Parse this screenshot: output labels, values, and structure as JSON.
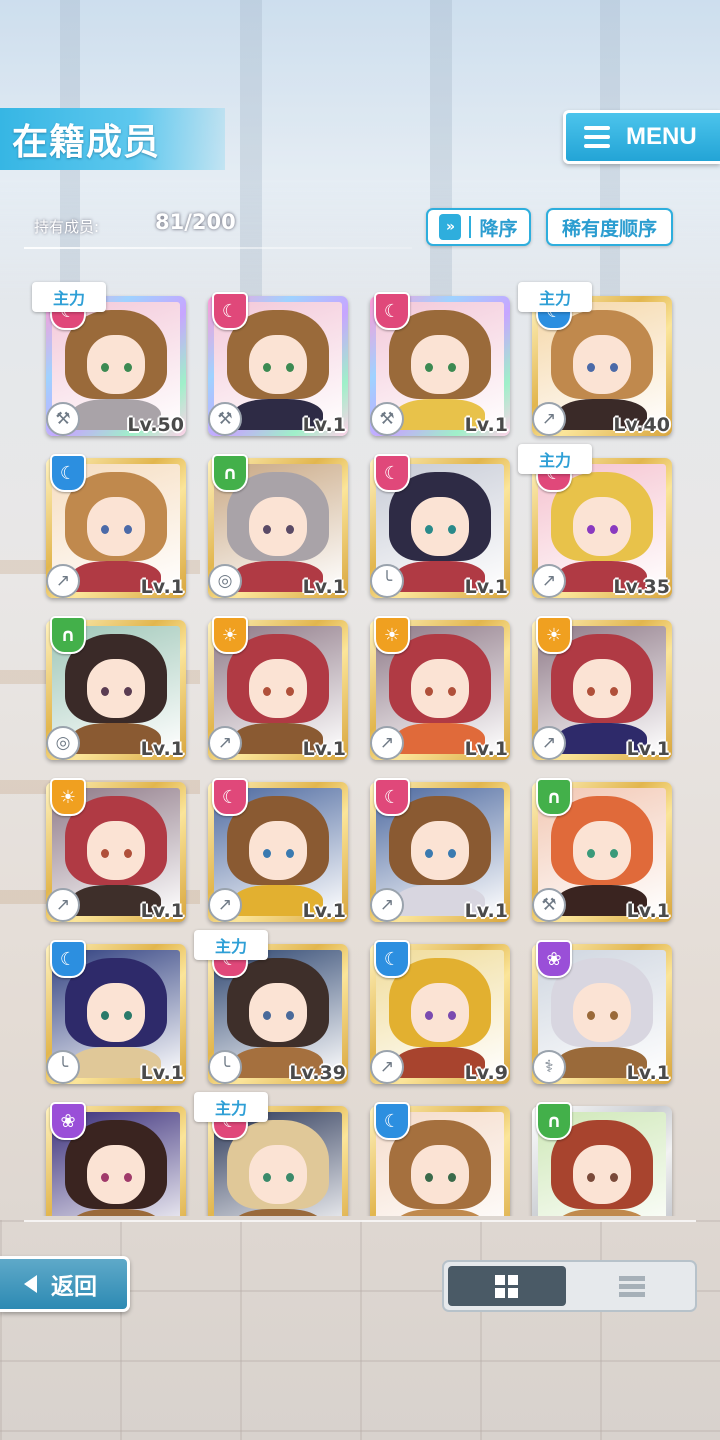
{
  "header": {
    "title": "在籍成员",
    "menu_label": "MENU"
  },
  "stats": {
    "label": "持有成员:",
    "value": "81/200"
  },
  "sort": {
    "direction_label": "降序",
    "key_label": "稀有度顺序"
  },
  "main_tag_label": "主力",
  "colors": {
    "accent": "#2eaedd",
    "pink": "#e0487a",
    "blue": "#2c8fe0",
    "green": "#43b04a",
    "orange": "#f0a020",
    "purple": "#9a4fd8"
  },
  "members": [
    {
      "level": "Lv.50",
      "main": true,
      "attribute": "pink",
      "frame": "rainbow",
      "weapon": "hammer-icon"
    },
    {
      "level": "Lv.1",
      "main": false,
      "attribute": "pink",
      "frame": "rainbow",
      "weapon": "hammer-icon"
    },
    {
      "level": "Lv.1",
      "main": false,
      "attribute": "pink",
      "frame": "rainbow",
      "weapon": "hammer-icon"
    },
    {
      "level": "Lv.40",
      "main": true,
      "attribute": "blue",
      "frame": "gold",
      "weapon": "spear-icon"
    },
    {
      "level": "Lv.1",
      "main": false,
      "attribute": "blue",
      "frame": "gold",
      "weapon": "spear-icon"
    },
    {
      "level": "Lv.1",
      "main": false,
      "attribute": "green",
      "frame": "gold",
      "weapon": "shield-icon"
    },
    {
      "level": "Lv.1",
      "main": false,
      "attribute": "pink",
      "frame": "gold",
      "weapon": "gun-icon"
    },
    {
      "level": "Lv.35",
      "main": true,
      "attribute": "pink",
      "frame": "gold",
      "weapon": "spear-icon"
    },
    {
      "level": "Lv.1",
      "main": false,
      "attribute": "green",
      "frame": "gold",
      "weapon": "shield-icon"
    },
    {
      "level": "Lv.1",
      "main": false,
      "attribute": "orange",
      "frame": "gold",
      "weapon": "spear-icon"
    },
    {
      "level": "Lv.1",
      "main": false,
      "attribute": "orange",
      "frame": "gold",
      "weapon": "spear-icon"
    },
    {
      "level": "Lv.1",
      "main": false,
      "attribute": "orange",
      "frame": "gold",
      "weapon": "spear-icon"
    },
    {
      "level": "Lv.1",
      "main": false,
      "attribute": "orange",
      "frame": "gold",
      "weapon": "spear-icon"
    },
    {
      "level": "Lv.1",
      "main": false,
      "attribute": "pink",
      "frame": "gold",
      "weapon": "spear-icon"
    },
    {
      "level": "Lv.1",
      "main": false,
      "attribute": "pink",
      "frame": "gold",
      "weapon": "spear-icon"
    },
    {
      "level": "Lv.1",
      "main": false,
      "attribute": "green",
      "frame": "gold",
      "weapon": "hammer-icon"
    },
    {
      "level": "Lv.1",
      "main": false,
      "attribute": "blue",
      "frame": "gold",
      "weapon": "gun-icon"
    },
    {
      "level": "Lv.39",
      "main": true,
      "attribute": "pink",
      "frame": "gold",
      "weapon": "gun-icon"
    },
    {
      "level": "Lv.9",
      "main": false,
      "attribute": "blue",
      "frame": "gold",
      "weapon": "spear-icon"
    },
    {
      "level": "Lv.1",
      "main": false,
      "attribute": "purple",
      "frame": "gold",
      "weapon": "staff-icon"
    },
    {
      "level": "",
      "main": false,
      "attribute": "purple",
      "frame": "gold",
      "weapon": ""
    },
    {
      "level": "",
      "main": true,
      "attribute": "pink",
      "frame": "gold",
      "weapon": ""
    },
    {
      "level": "",
      "main": false,
      "attribute": "blue",
      "frame": "gold",
      "weapon": ""
    },
    {
      "level": "",
      "main": false,
      "attribute": "green",
      "frame": "silver",
      "weapon": ""
    }
  ],
  "footer": {
    "back_label": "返回",
    "view_modes": [
      "grid-view-icon",
      "list-view-icon"
    ],
    "active_view": "grid-view-icon"
  }
}
